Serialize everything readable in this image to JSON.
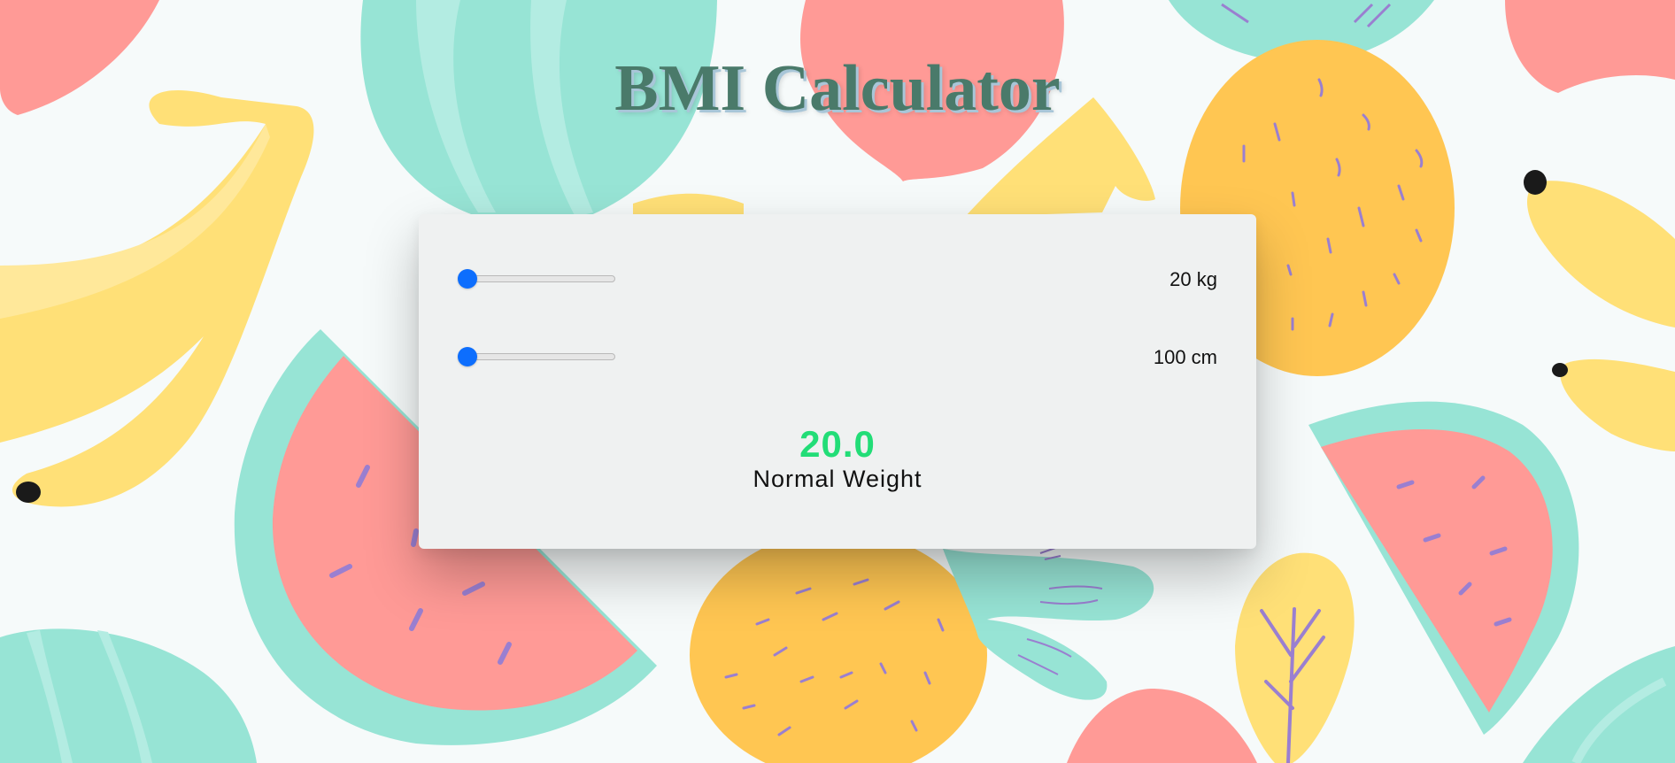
{
  "header": {
    "title": "BMI Calculator"
  },
  "calculator": {
    "weight": {
      "value_label": "20 kg",
      "level": 0.0
    },
    "height": {
      "value_label": "100 cm",
      "level": 0.0
    },
    "result": {
      "bmi": "20.0",
      "category": "Normal Weight",
      "color": "#22dd77"
    }
  },
  "theme": {
    "card_bg": "#eff1f1",
    "slider_accent": "#0d6efd",
    "title_color": "#4a7a6a"
  }
}
